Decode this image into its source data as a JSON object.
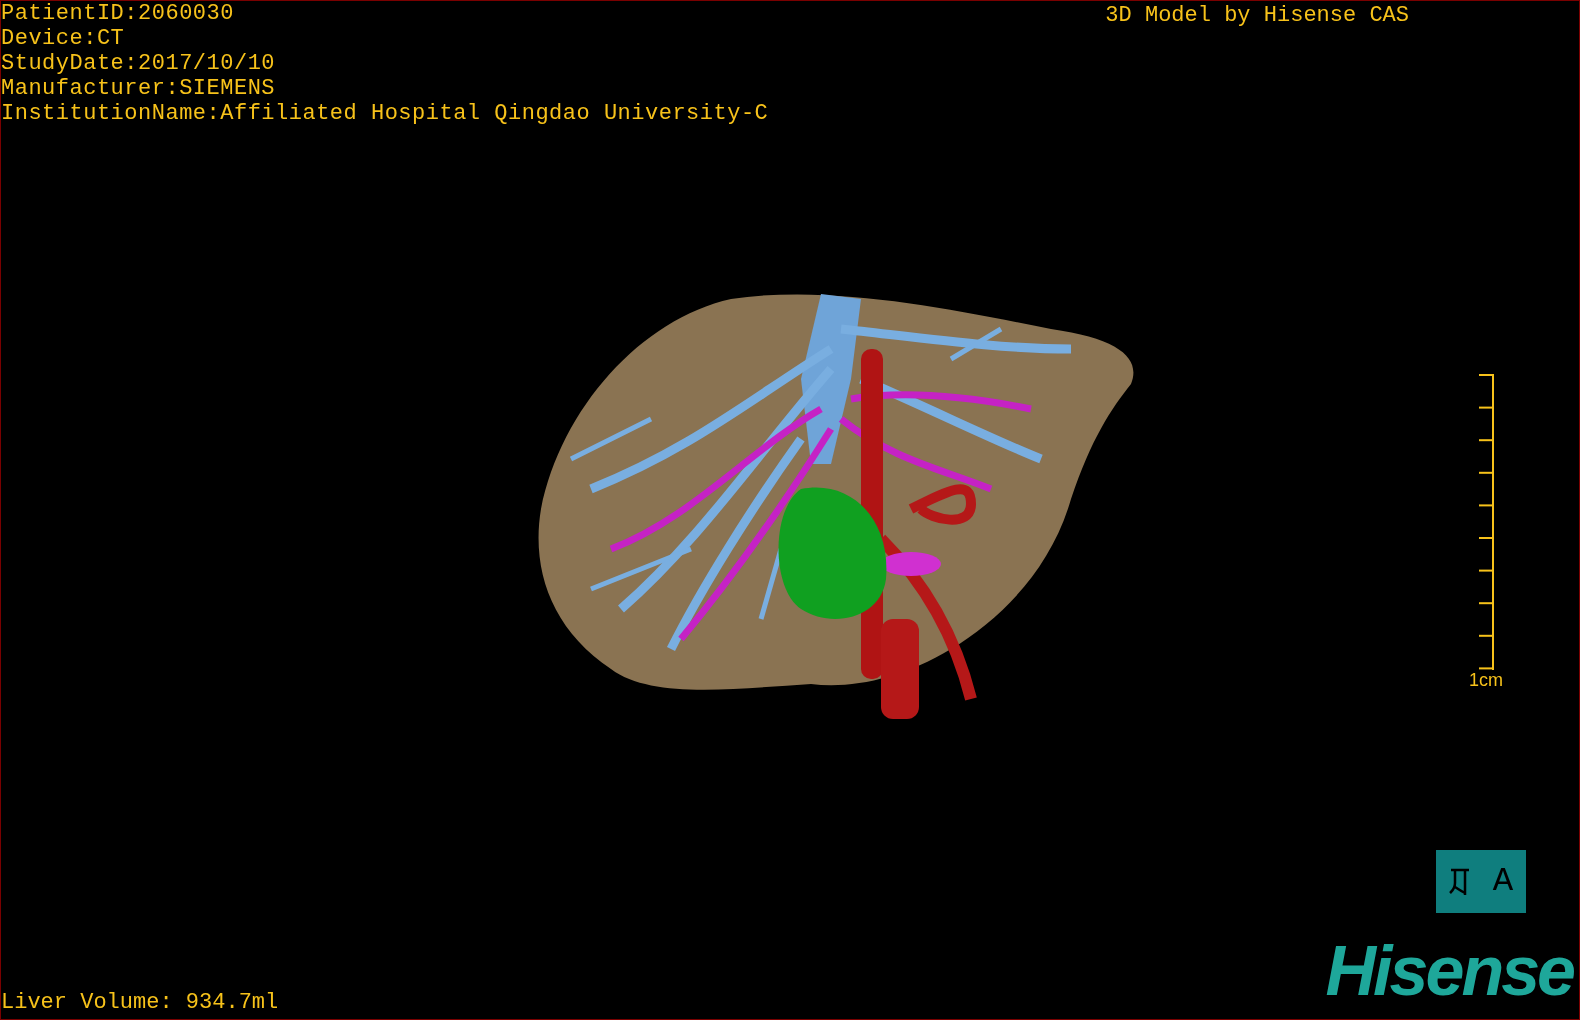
{
  "info_lines": [
    "PatientID:2060030",
    "Device:CT",
    "StudyDate:2017/10/10",
    "Manufacturer:SIEMENS",
    "InstitutionName:Affiliated Hospital Qingdao University-C"
  ],
  "model_credit": "3D Model by Hisense CAS",
  "scale_bar": {
    "label": "1cm"
  },
  "orientation_cube": {
    "label": "A"
  },
  "logo": "Hisense",
  "liver_volume": "Liver Volume: 934.7ml"
}
